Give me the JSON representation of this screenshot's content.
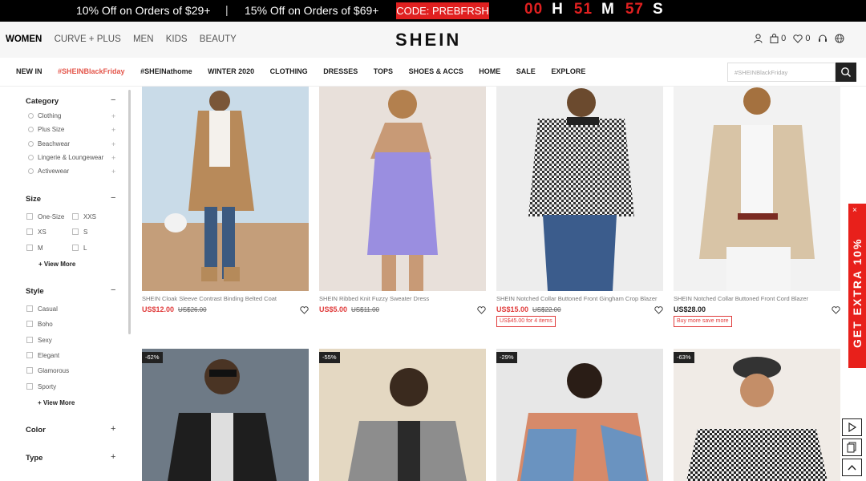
{
  "promo": {
    "offer1": "10% Off on Orders of $29+",
    "separator": "|",
    "offer2": "15% Off on Orders of $69+",
    "code": "CODE: PREBFRSH",
    "timer": [
      {
        "num": "00",
        "unit": "H"
      },
      {
        "num": "51",
        "unit": "M"
      },
      {
        "num": "57",
        "unit": "S"
      }
    ]
  },
  "header": {
    "categories": [
      "WOMEN",
      "CURVE + PLUS",
      "MEN",
      "KIDS",
      "BEAUTY"
    ],
    "logo": "SHEIN",
    "bag_count": "0",
    "wishlist_count": "0"
  },
  "nav": {
    "items": [
      "NEW IN",
      "#SHEINBlackFriday",
      "#SHEINathome",
      "WINTER 2020",
      "CLOTHING",
      "DRESSES",
      "TOPS",
      "SHOES & ACCS",
      "HOME",
      "SALE",
      "EXPLORE"
    ],
    "search_placeholder": "#SHEINBlackFriday"
  },
  "sidebar": {
    "category": {
      "title": "Category",
      "items": [
        "Clothing",
        "Plus Size",
        "Beachwear",
        "Lingerie & Loungewear",
        "Activewear"
      ]
    },
    "size": {
      "title": "Size",
      "items": [
        "One-Size",
        "XXS",
        "XS",
        "S",
        "M",
        "L"
      ],
      "more": "+ View More"
    },
    "style": {
      "title": "Style",
      "items": [
        "Casual",
        "Boho",
        "Sexy",
        "Elegant",
        "Glamorous",
        "Sporty"
      ],
      "more": "+ View More"
    },
    "color": {
      "title": "Color"
    },
    "type": {
      "title": "Type"
    },
    "collapse_symbol": "−",
    "expand_symbol": "+"
  },
  "products": [
    {
      "title": "SHEIN Cloak Sleeve Contrast Binding Belted Coat",
      "price": "US$12.00",
      "original": "US$26.00",
      "tag": "",
      "palette": [
        "#c9dbe8",
        "#b88a5a",
        "#3c5a80"
      ]
    },
    {
      "title": "SHEIN Ribbed Knit Fuzzy Sweater Dress",
      "price": "US$5.00",
      "original": "US$11.00",
      "tag": "",
      "palette": [
        "#e8e0da",
        "#9a8ee0",
        "#c89a76"
      ]
    },
    {
      "title": "SHEIN Notched Collar Buttoned Front Gingham Crop Blazer",
      "price": "US$15.00",
      "original": "US$22.00",
      "tag": "US$45.00 for 4 items",
      "palette": [
        "#ededed",
        "#555555",
        "#3b5c8c"
      ]
    },
    {
      "title": "SHEIN Notched Collar Buttoned Front Cord Blazer",
      "price": "US$28.00",
      "original": "",
      "tag": "Buy more save more",
      "palette": [
        "#f2f2f2",
        "#d8c4a6",
        "#f5f5f5"
      ]
    },
    {
      "discount": "-62%",
      "palette": [
        "#6e7a86",
        "#1e1e1e",
        "#dedede"
      ]
    },
    {
      "discount": "-55%",
      "palette": [
        "#e4d8c2",
        "#8d8d8d",
        "#2a2a2a"
      ]
    },
    {
      "discount": "-29%",
      "palette": [
        "#e7e7e7",
        "#d68a6a",
        "#6a93c0"
      ]
    },
    {
      "discount": "-63%",
      "palette": [
        "#f0ebe6",
        "#222222",
        "#efefef"
      ]
    }
  ],
  "extra_banner": {
    "text": "GET EXTRA 10%",
    "close": "×"
  }
}
